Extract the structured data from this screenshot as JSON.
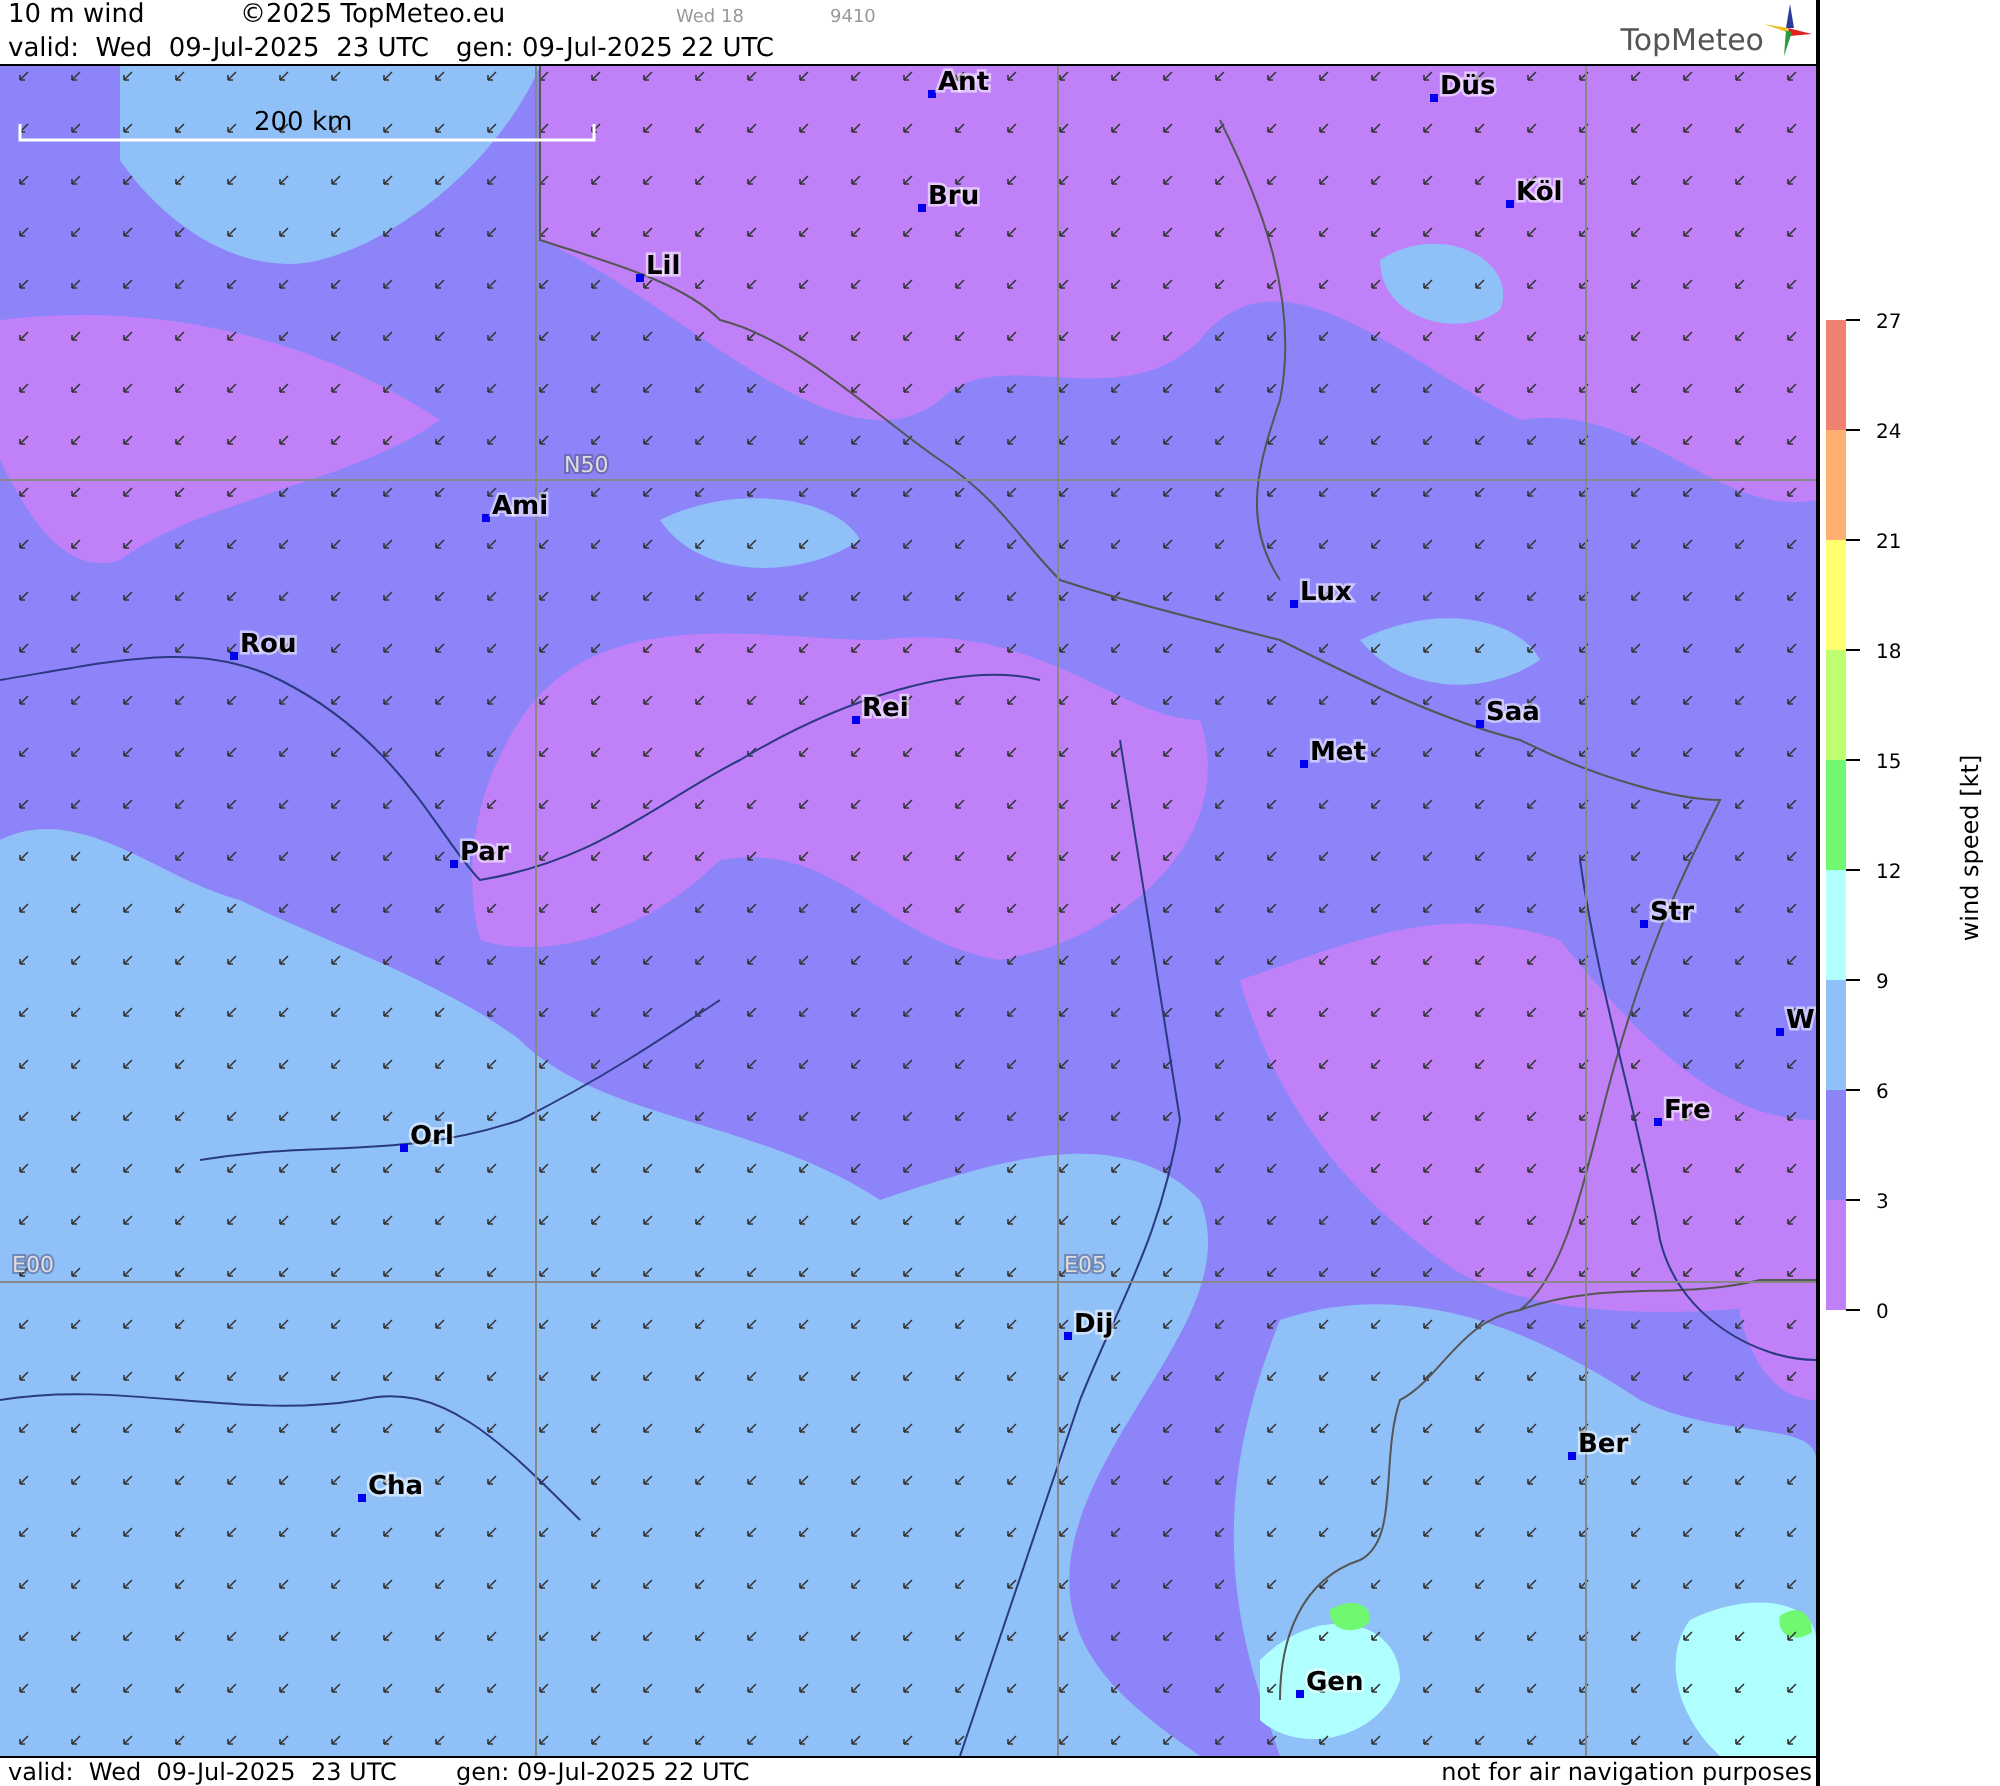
{
  "header": {
    "title": "10 m wind",
    "copyright": "©2025 TopMeteo.eu",
    "day": "Wed 18",
    "code": "9410",
    "valid": "valid:  Wed  09-Jul-2025  23 UTC",
    "generated": "gen: 09-Jul-2025 22 UTC",
    "logo": "TopMeteo"
  },
  "map": {
    "scale": "200 km",
    "grid_labels": [
      "N50",
      "E00",
      "E05"
    ],
    "cities": [
      "Ant",
      "Düs",
      "Bru",
      "Köl",
      "Lil",
      "Ami",
      "Lux",
      "Rou",
      "Rei",
      "Saa",
      "Met",
      "Par",
      "Str",
      "W",
      "Fre",
      "Orl",
      "Dij",
      "Ber",
      "Cha",
      "Gen"
    ]
  },
  "legend": {
    "title": "wind speed [kt]",
    "ticks": [
      "27",
      "24",
      "21",
      "18",
      "15",
      "12",
      "9",
      "6",
      "3",
      "0"
    ],
    "bands": [
      {
        "color": "#f08070"
      },
      {
        "color": "#ffb070"
      },
      {
        "color": "#ffff70"
      },
      {
        "color": "#c0ff70"
      },
      {
        "color": "#70f870"
      },
      {
        "color": "#b0ffff"
      },
      {
        "color": "#90c0f8"
      },
      {
        "color": "#8c84f8"
      },
      {
        "color": "#c080f8"
      }
    ]
  },
  "footer": {
    "valid": "valid:  Wed  09-Jul-2025  23 UTC",
    "generated": "gen: 09-Jul-2025 22 UTC",
    "note": "not for air navigation purposes"
  }
}
